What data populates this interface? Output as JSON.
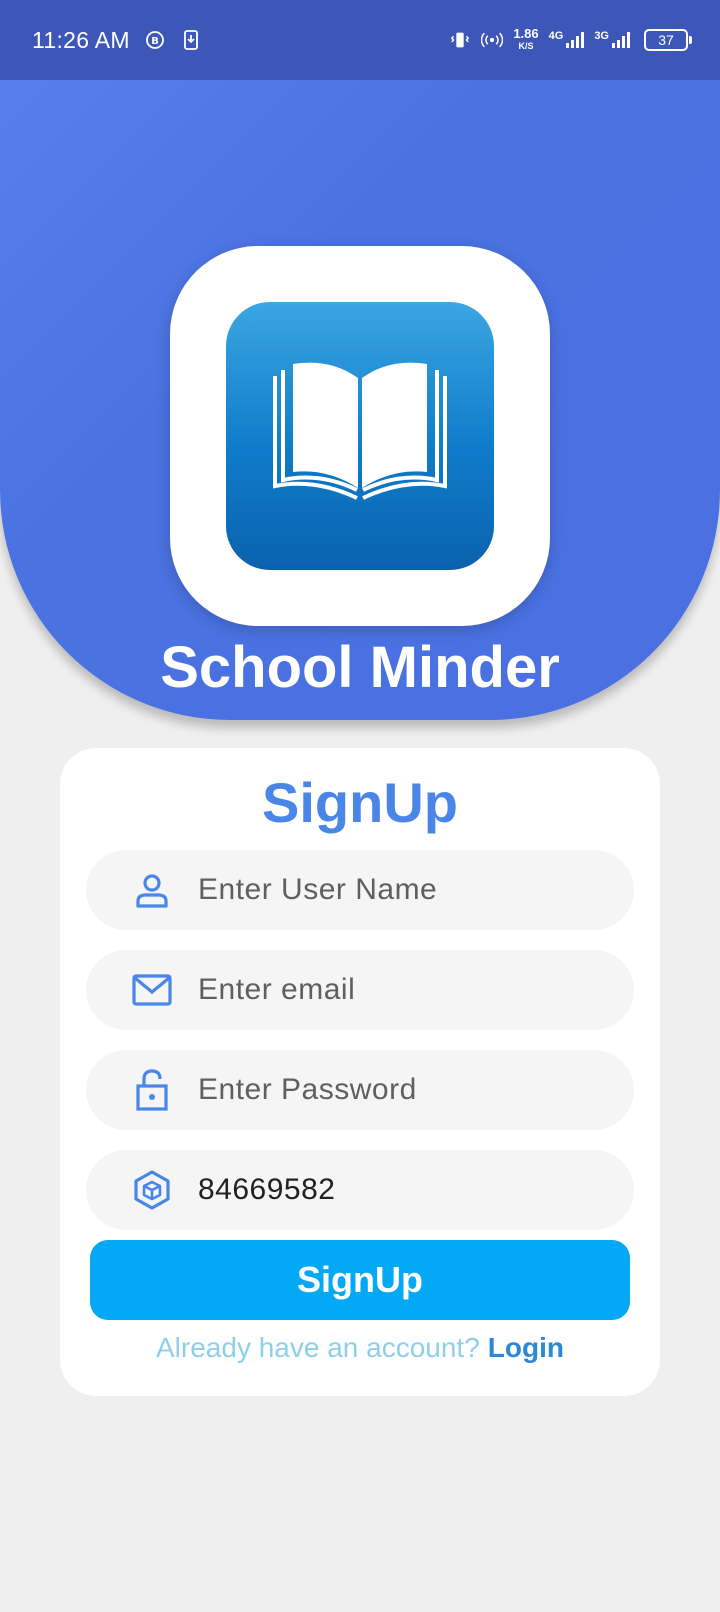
{
  "status_bar": {
    "time": "11:26 AM",
    "speed_value": "1.86",
    "speed_unit": "K/S",
    "net1": "4G",
    "net2": "3G",
    "battery": "37"
  },
  "app": {
    "title": "School Minder"
  },
  "form": {
    "title": "SignUp",
    "username_placeholder": "Enter User Name",
    "email_placeholder": "Enter email",
    "password_placeholder": "Enter Password",
    "code_value": "84669582",
    "submit_label": "SignUp",
    "login_prompt": "Already have an account?",
    "login_link": "Login"
  },
  "colors": {
    "header": "#4a72e0",
    "status_bar": "#3d57b8",
    "accent": "#4a86e8",
    "button": "#03a9f4",
    "link": "#2a88d8"
  },
  "icons": [
    "user-icon",
    "mail-icon",
    "lock-icon",
    "cube-icon",
    "book-icon"
  ]
}
